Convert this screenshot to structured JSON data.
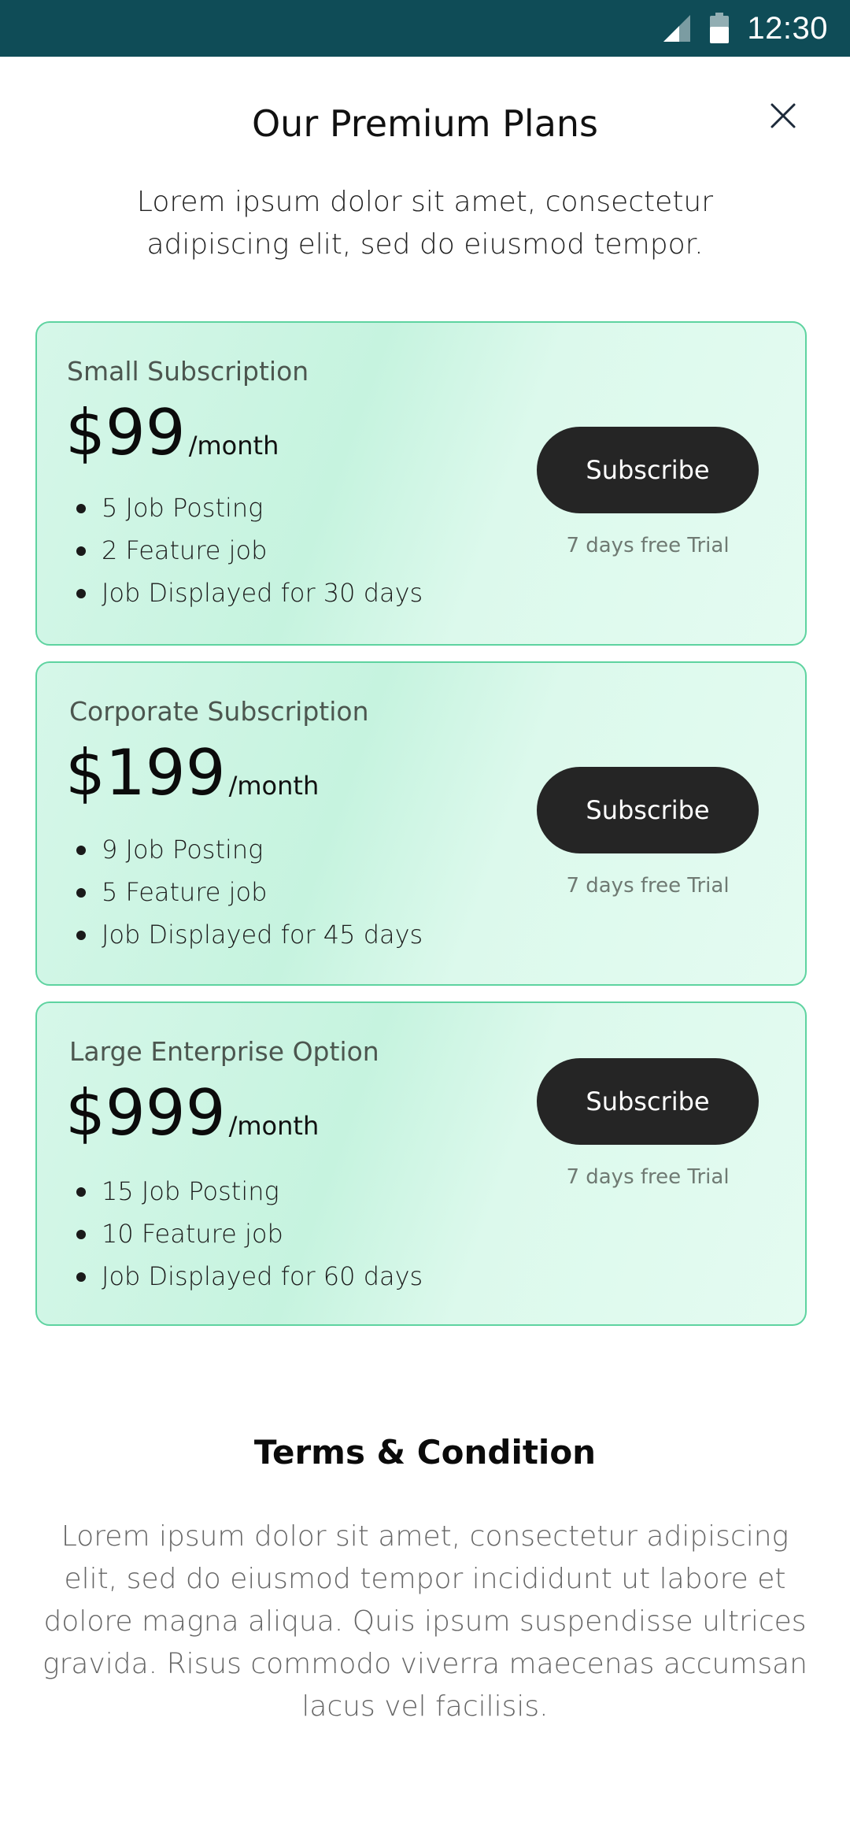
{
  "status_bar": {
    "time": "12:30",
    "icons": [
      "signal-icon",
      "battery-icon"
    ]
  },
  "header": {
    "title": "Our Premium Plans",
    "subtitle": "Lorem ipsum dolor sit amet, consectetur adipiscing elit, sed do eiusmod tempor.",
    "close_icon": "close-icon"
  },
  "plans": [
    {
      "name": "Small Subscription",
      "price": "$99",
      "period": "/month",
      "features": [
        "5 Job Posting",
        "2 Feature job",
        "Job Displayed for 30 days"
      ],
      "button_label": "Subscribe",
      "trial_note": "7 days free Trial"
    },
    {
      "name": "Corporate Subscription",
      "price": "$199",
      "period": "/month",
      "features": [
        "9 Job Posting",
        "5 Feature job",
        "Job Displayed for 45 days"
      ],
      "button_label": "Subscribe",
      "trial_note": "7 days free Trial"
    },
    {
      "name": "Large Enterprise Option",
      "price": "$999",
      "period": "/month",
      "features": [
        "15 Job Posting",
        "10 Feature job",
        "Job Displayed for 60 days"
      ],
      "button_label": "Subscribe",
      "trial_note": "7 days free Trial"
    }
  ],
  "terms": {
    "title": "Terms & Condition",
    "body": "Lorem ipsum dolor sit amet, consectetur adipiscing elit, sed do eiusmod tempor incididunt ut labore et dolore magna aliqua. Quis ipsum suspendisse ultrices gravida. Risus commodo viverra maecenas accumsan lacus vel facilisis."
  },
  "colors": {
    "status_bar": "#0f4c57",
    "card_border": "#5ed3a0",
    "card_bg": "#d6f7e9",
    "button_bg": "#252525"
  }
}
